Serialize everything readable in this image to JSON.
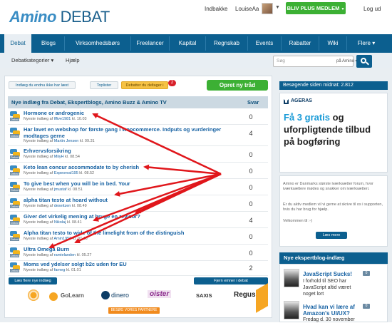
{
  "header": {
    "logo_amino": "Amino",
    "logo_debat": "DEBAT",
    "inbox": "Indbakke",
    "username": "LouiseAa",
    "plus_button": "BLIV PLUS MEDLEM",
    "logout": "Log ud"
  },
  "nav": {
    "tabs": [
      "Debat",
      "Blogs",
      "Virksomhedsbørs",
      "Freelancer",
      "Kapital",
      "Regnskab",
      "Events",
      "Rabatter",
      "Wiki",
      "Flere ▾"
    ]
  },
  "subnav": {
    "categories": "Debatkategorier ▾",
    "help": "Hjælp",
    "search_placeholder": "Søg",
    "search_scope": "på Amino ▾"
  },
  "toolbar": {
    "unread": "Indlæg du endnu ikke har læst",
    "toplists": "Toplister",
    "participating": "Debatter du deltager i",
    "participating_badge": "2",
    "new_thread": "Opret ny tråd"
  },
  "threads": {
    "heading": "Nye indlæg fra Debat, Ekspertblogs, Amino Buzz & Amino TV",
    "count_header": "Svar",
    "icon_tag": "Debat",
    "rows": [
      {
        "title": "Hormone or androgenic",
        "author": "lffive1981",
        "time": "10.03",
        "count": "0"
      },
      {
        "title": "Har lavet en webshop for første gang i woocommerce. Indputs og vurderinger modtages gerne",
        "author": "Martin Jensen",
        "time": "09.31",
        "count": "4"
      },
      {
        "title": "Erhvervsforsikring",
        "author": "MiiyH",
        "time": "08.54",
        "count": "0"
      },
      {
        "title": "Keto lean concur accommodate to by cherish",
        "author": "Expeoreal195",
        "time": "08.52",
        "count": "0"
      },
      {
        "title": "To give best when you will be in bed. Your",
        "author": "jmustaf",
        "time": "08.51",
        "count": "0"
      },
      {
        "title": "alpha titan testo at hoard without",
        "author": "deseitzen",
        "time": "08.49",
        "count": "0"
      },
      {
        "title": "Giver det virkelig mening at bruge en revisor?",
        "author": "Nikolaj",
        "time": "08.41",
        "count": "4"
      },
      {
        "title": "Alpha titan testo to wide of the limelight from of the distinguish",
        "author": "Amin1956",
        "time": "07.48",
        "count": "0"
      },
      {
        "title": "Ultra Omega Burn",
        "author": "ramielanden",
        "time": "05.27",
        "count": "0"
      },
      {
        "title": "Moms ved ydelser solgt b2c uden for EU",
        "author": "farneg",
        "time": "01.01",
        "count": "2"
      }
    ],
    "meta_prefix": "Nyeste indlæg af",
    "meta_kl": "kl."
  },
  "footer": {
    "more": "Læs flere nye indlæg",
    "remove": "Fjern emner i debat",
    "partners": [
      "GoLearn",
      "dinero",
      "oister",
      "SAXIS",
      "Regus"
    ],
    "visit_partners": "BESØG VORES PARTNERE"
  },
  "sidebar": {
    "visitors": "Besøgende siden midnat: 2.812",
    "ad": {
      "brand": "AGERAS",
      "line1_accent": "Få 3 gratis",
      "line1_rest": " og uforpligtende tilbud på bogføring"
    },
    "info_p1": "Amino er Danmarks største iværksætter forum, hvor iværksættere mødes og snakker om iværksætteri.",
    "info_p2": "Er du aktiv medlem vil vi gerne at skrive til os i supporten, hvis du har brug for hjælp.",
    "info_p3": "Velkommen til :-)",
    "read_more": "Læs mere",
    "expert_heading": "Nye ekspertblog-indlæg",
    "expert_posts": [
      {
        "title": "JavaScript Sucks!",
        "text": "I forhold til SEO har JavaScript altid været noget lort",
        "count": "0"
      },
      {
        "title": "Hvad kan vi lære af Amazon's UI/UX?",
        "text": "Fredag d. 30 november",
        "count": "0"
      }
    ]
  },
  "colors": {
    "primary": "#0c5f8f",
    "green": "#3cb034",
    "arrow": "#e0161b"
  }
}
